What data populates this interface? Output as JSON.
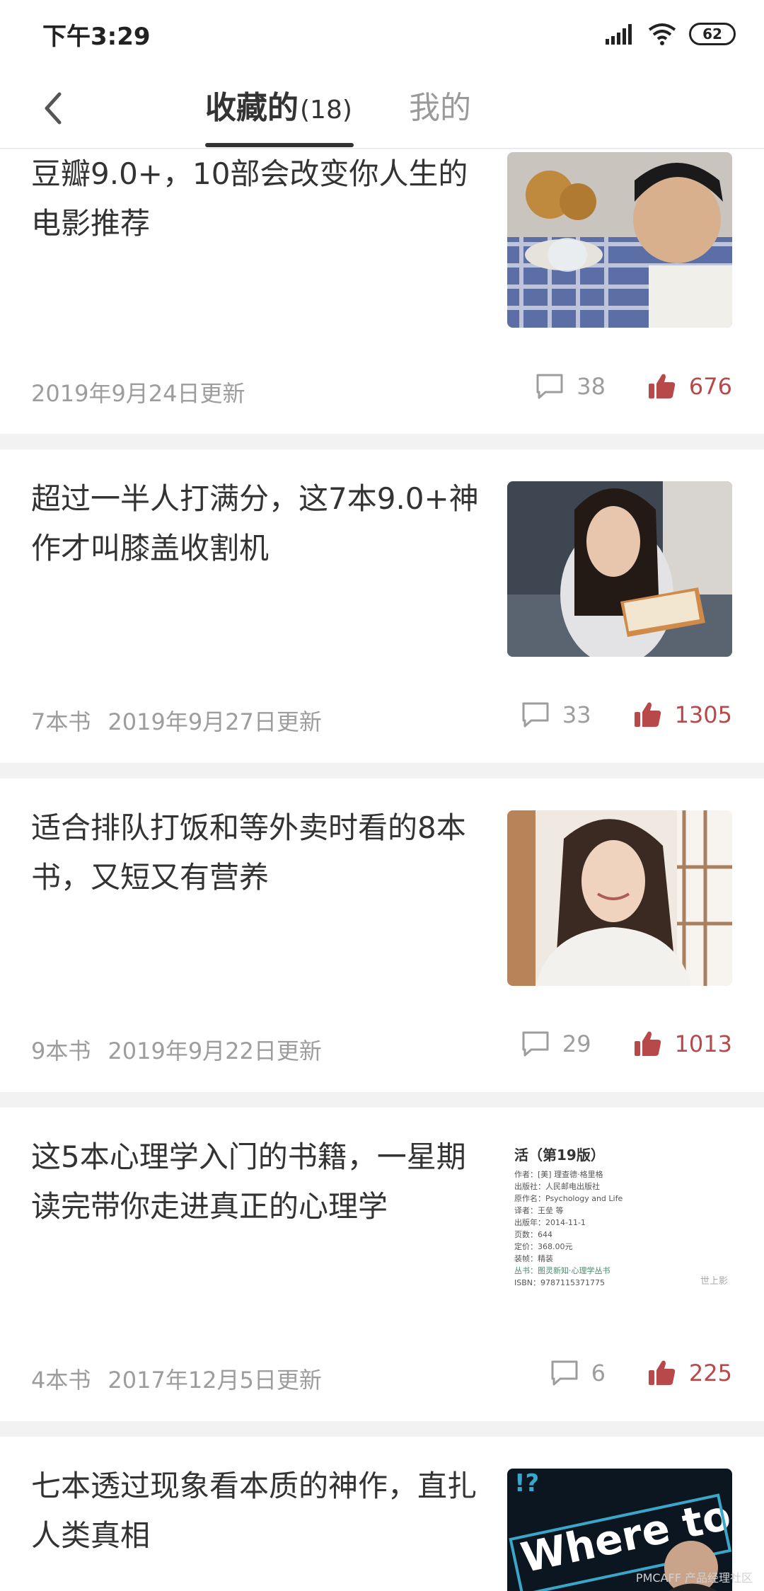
{
  "status_bar": {
    "time": "下午3:29",
    "battery": "62"
  },
  "nav": {
    "tab_collected_label": "收藏的",
    "tab_collected_count": "(18)",
    "tab_mine_label": "我的"
  },
  "colors": {
    "accent_like": "#b8494a",
    "muted_text": "#9d9d9d",
    "title_text": "#333333"
  },
  "cards": [
    {
      "title": "豆瓣9.0+，10部会改变你人生的电影推荐",
      "book_count": "",
      "updated": "2019年9月24日更新",
      "comments": "38",
      "likes": "676"
    },
    {
      "title": "超过一半人打满分，这7本9.0+神作才叫膝盖收割机",
      "book_count": "7本书",
      "updated": "2019年9月27日更新",
      "comments": "33",
      "likes": "1305"
    },
    {
      "title": "适合排队打饭和等外卖时看的8本书，又短又有营养",
      "book_count": "9本书",
      "updated": "2019年9月22日更新",
      "comments": "29",
      "likes": "1013"
    },
    {
      "title": "这5本心理学入门的书籍，一星期读完带你走进真正的心理学",
      "book_count": "4本书",
      "updated": "2017年12月5日更新",
      "comments": "6",
      "likes": "225"
    },
    {
      "title": "七本透过现象看本质的神作，直扎人类真相",
      "book_count": "",
      "updated": "",
      "comments": "",
      "likes": ""
    }
  ],
  "thumb_texts": {
    "book_page_title": "活（第19版）",
    "book_page_lines": [
      "作者：[美] 理查德·格里格",
      "出版社：人民邮电出版社",
      "原作名：Psychology and Life",
      "译者：王垒 等",
      "出版年：2014-11-1",
      "页数：644",
      "定价：368.00元",
      "装帧：精装",
      "丛书：图灵新知·心理学丛书",
      "ISBN：9787115371775"
    ],
    "book_page_mark": "世上影",
    "poster_text": "Where to",
    "poster_punct": "!?"
  },
  "watermark": "PMCAFF 产品经理社区"
}
